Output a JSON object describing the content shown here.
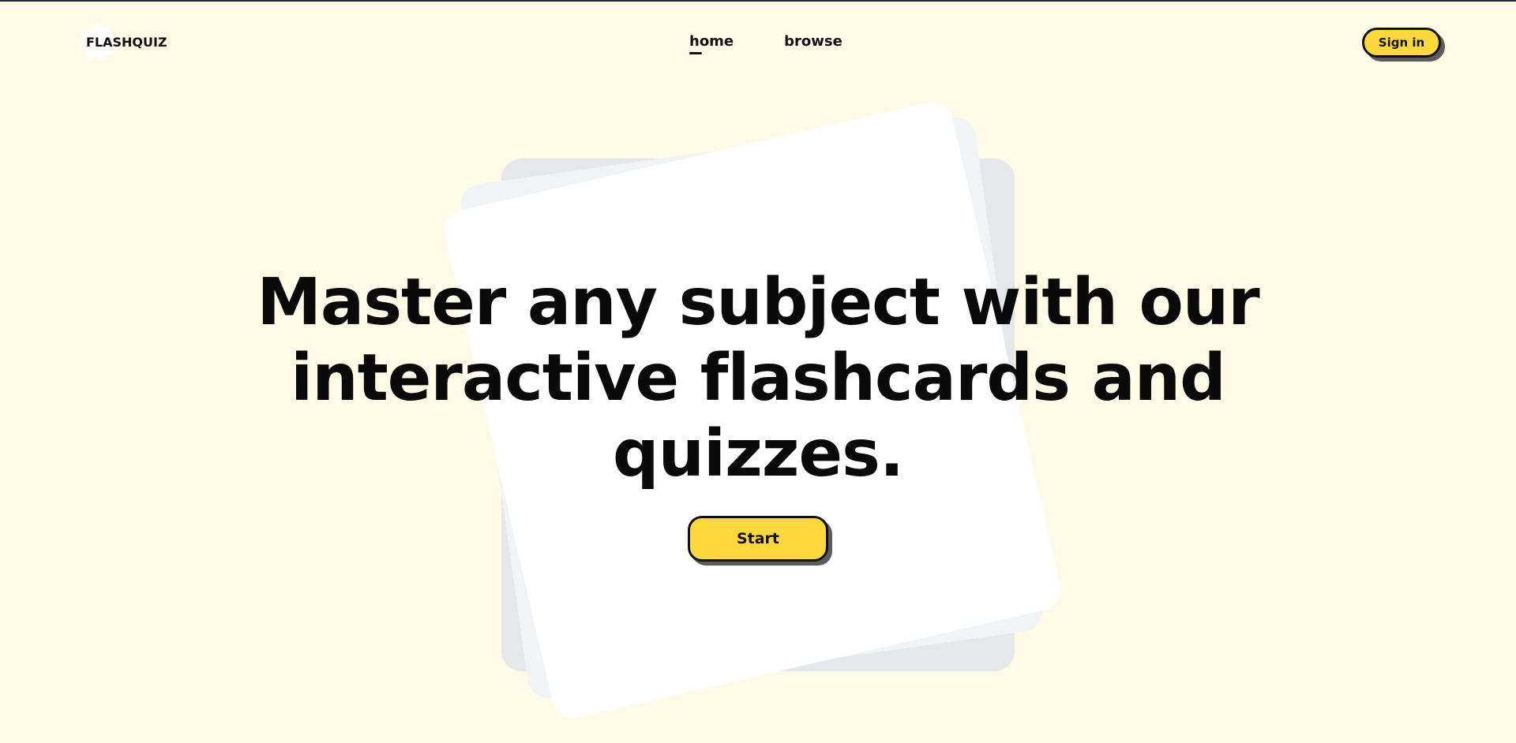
{
  "brand": {
    "logo_text": "FLASHQUIZ"
  },
  "nav": {
    "items": [
      {
        "label": "home",
        "active": true
      },
      {
        "label": "browse",
        "active": false
      }
    ]
  },
  "header": {
    "signin_label": "Sign in"
  },
  "hero": {
    "headline": "Master any subject with our interactive flashcards and quizzes.",
    "start_label": "Start"
  },
  "colors": {
    "background": "#fffae6",
    "accent": "#ffd83d",
    "text": "#0a0a0a",
    "button_shadow": "#5c5c5c",
    "card_front": "#ffffff",
    "card_mid": "#f2f3f5",
    "card_back": "#e6e7eb"
  }
}
